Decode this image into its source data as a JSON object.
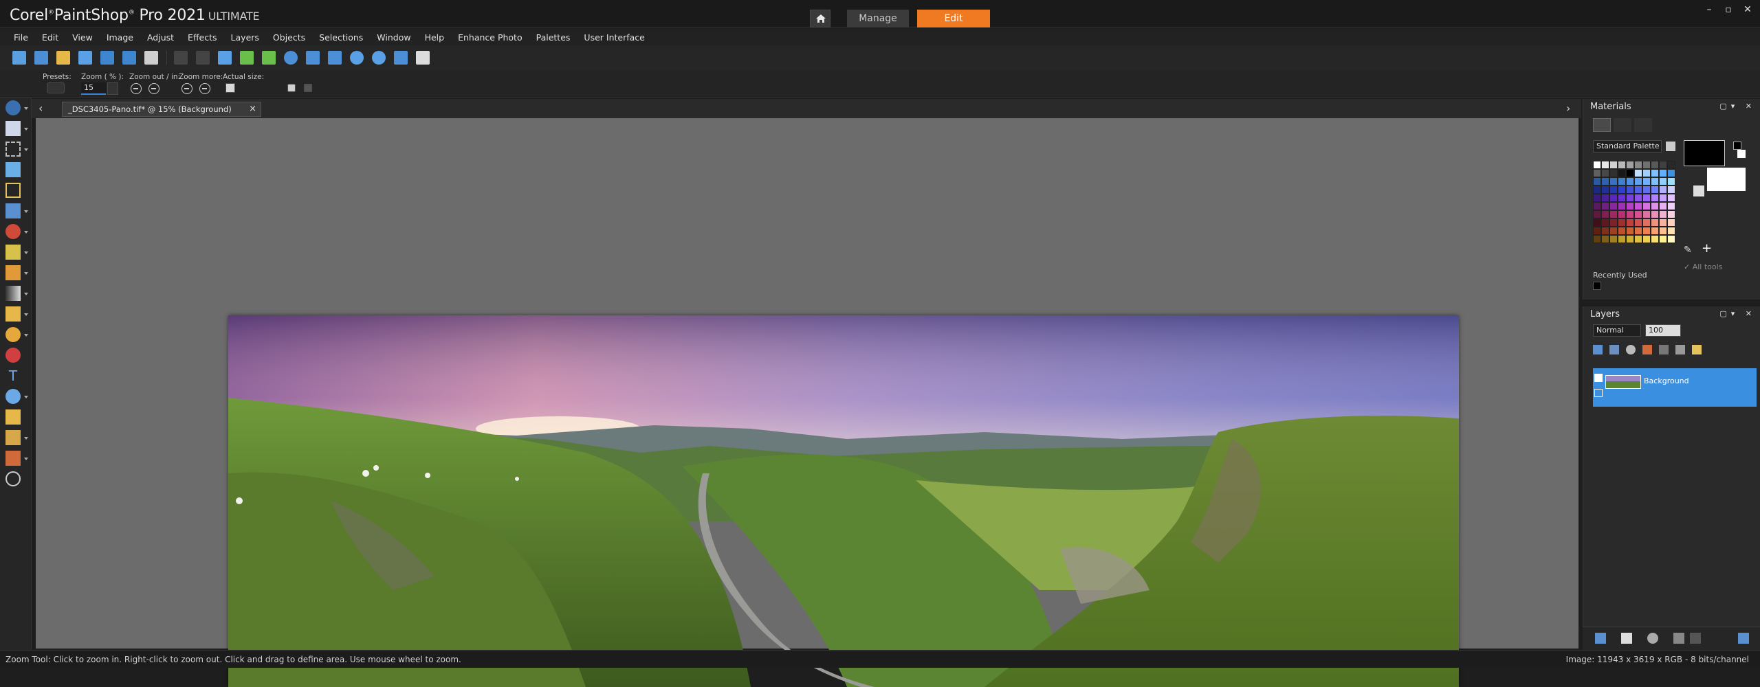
{
  "app": {
    "brand_corel": "Corel",
    "brand_product": "PaintShop",
    "brand_pro": "Pro 2021",
    "brand_edition": "ULTIMATE",
    "accent_color": "#f07a22",
    "selection_color": "#3a8fe0"
  },
  "modes": {
    "home_icon": "home-icon",
    "manage_label": "Manage",
    "edit_label": "Edit"
  },
  "menu": [
    "File",
    "Edit",
    "View",
    "Image",
    "Adjust",
    "Effects",
    "Layers",
    "Objects",
    "Selections",
    "Window",
    "Help",
    "Enhance Photo",
    "Palettes",
    "User Interface"
  ],
  "options": {
    "presets_label": "Presets:",
    "zoom_label": "Zoom ( % ):",
    "zoom_value": "15",
    "zoom_out_in_label": "Zoom out / in:",
    "zoom_more_label": "Zoom more:",
    "actual_size_label": "Actual size:"
  },
  "document": {
    "tab_label": "_DSC3405-Pano.tif* @  15% (Background)",
    "close_glyph": "×",
    "nav_left": "‹",
    "nav_right": "›"
  },
  "materials": {
    "title": "Materials",
    "palette_select": "Standard Palette",
    "all_tools_label": "All tools",
    "recently_used_label": "Recently Used"
  },
  "layers": {
    "title": "Layers",
    "blend_mode": "Normal",
    "opacity": "100",
    "layer_name": "Background"
  },
  "status": {
    "hint": "Zoom Tool: Click to zoom in. Right-click to zoom out. Click and drag to define area. Use mouse wheel to zoom.",
    "image_info": "Image:  11943 x 3619 x RGB - 8 bits/channel"
  }
}
